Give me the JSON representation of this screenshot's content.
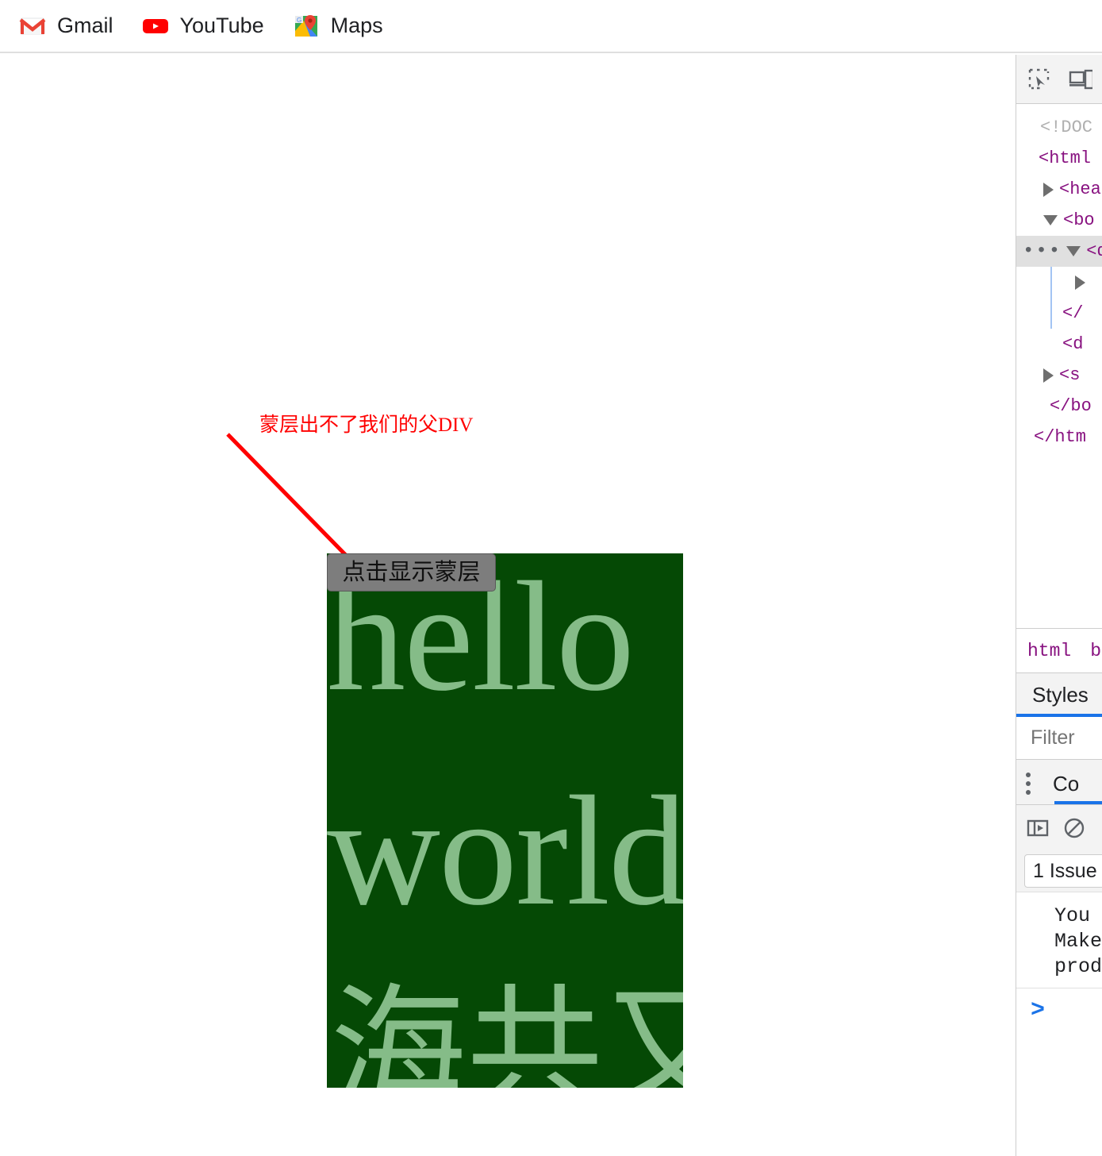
{
  "bookmarks_bar": {
    "items": [
      {
        "label": "Gmail",
        "icon": "gmail-icon"
      },
      {
        "label": "YouTube",
        "icon": "youtube-icon"
      },
      {
        "label": "Maps",
        "icon": "google-maps-icon"
      }
    ]
  },
  "page": {
    "annotation": {
      "text": "蒙层出不了我们的父DIV",
      "color": "#ff0000"
    },
    "demo_box": {
      "background_color": "#054905",
      "text_color": "#85bc88",
      "button_label": "点击显示蒙层",
      "heading_line1": "hello",
      "heading_line2": "world",
      "heading_line3": "海共又"
    }
  },
  "devtools": {
    "toolbar": {
      "inspect_icon": "inspect-element-icon",
      "device_icon": "device-toolbar-icon"
    },
    "elements_panel": {
      "dom_rows": [
        {
          "text": "<!DOC",
          "type": "doctype",
          "triangle": "none",
          "indent": 0,
          "selected": false,
          "dots": false
        },
        {
          "text": "<html",
          "type": "tag",
          "triangle": "none",
          "indent": 0,
          "selected": false,
          "dots": false
        },
        {
          "text": "<hea",
          "type": "tag",
          "triangle": "closed",
          "indent": 1,
          "selected": false,
          "dots": false
        },
        {
          "text": "<bo",
          "type": "tag",
          "triangle": "open",
          "indent": 1,
          "selected": false,
          "dots": false
        },
        {
          "text": "<d",
          "type": "tag",
          "triangle": "open",
          "indent": 2,
          "selected": true,
          "dots": true
        },
        {
          "text": "",
          "type": "tag",
          "triangle": "closed",
          "indent": 3,
          "selected": false,
          "dots": false
        },
        {
          "text": "</",
          "type": "tag",
          "triangle": "none",
          "indent": 2,
          "selected": false,
          "dots": false
        },
        {
          "text": "<d",
          "type": "tag",
          "triangle": "none",
          "indent": 2,
          "selected": false,
          "dots": false
        },
        {
          "text": "<s",
          "type": "tag",
          "triangle": "closed",
          "indent": 1,
          "selected": false,
          "dots": false
        },
        {
          "text": "</bo",
          "type": "tag",
          "triangle": "none",
          "indent": 1,
          "selected": false,
          "dots": false
        },
        {
          "text": "</htm",
          "type": "tag",
          "triangle": "none",
          "indent": 0,
          "selected": false,
          "dots": false
        }
      ],
      "breadcrumb": [
        "html",
        "b"
      ]
    },
    "styles_panel": {
      "tab_label": "Styles",
      "filter_placeholder": "Filter"
    },
    "console_panel": {
      "tab_label": "Co",
      "sidebar_icon": "console-sidebar-icon",
      "clear_icon": "clear-console-icon",
      "issues_label": "1 Issue",
      "messages": "You \nMake\nprod",
      "prompt_chevron": ">"
    }
  }
}
